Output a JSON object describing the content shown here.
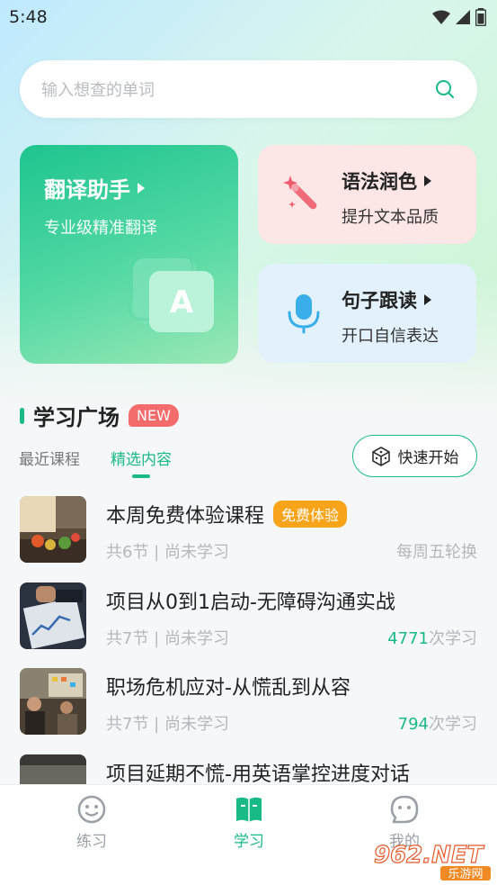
{
  "status_bar": {
    "time": "5:48"
  },
  "search": {
    "placeholder": "输入想查的单词"
  },
  "cards": {
    "translate": {
      "title": "翻译助手",
      "subtitle": "专业级精准翻译",
      "icon_letter": "A"
    },
    "grammar": {
      "title": "语法润色",
      "subtitle": "提升文本品质"
    },
    "reading": {
      "title": "句子跟读",
      "subtitle": "开口自信表达"
    }
  },
  "section": {
    "title": "学习广场",
    "badge": "NEW"
  },
  "tabs": [
    {
      "label": "最近课程",
      "active": false
    },
    {
      "label": "精选内容",
      "active": true
    }
  ],
  "quick_start": {
    "label": "快速开始"
  },
  "courses": [
    {
      "title": "本周免费体验课程",
      "badge": "免费体验",
      "meta": "共6节 | 尚未学习",
      "right_text": "每周五轮换"
    },
    {
      "title": "项目从0到1启动-无障碍沟通实战",
      "meta": "共7节 | 尚未学习",
      "count": "4771",
      "count_suffix": "次学习"
    },
    {
      "title": "职场危机应对-从慌乱到从容",
      "meta": "共7节 | 尚未学习",
      "count": "794",
      "count_suffix": "次学习"
    },
    {
      "title": "项目延期不慌-用英语掌控进度对话"
    }
  ],
  "bottom_nav": [
    {
      "label": "练习",
      "icon": "smile-icon",
      "active": false
    },
    {
      "label": "学习",
      "icon": "book-icon",
      "active": true
    },
    {
      "label": "我的",
      "icon": "chat-face-icon",
      "active": false
    }
  ],
  "watermark": {
    "text": "962.NET",
    "sub": "乐游网"
  },
  "colors": {
    "accent": "#1ab988",
    "badge_new": "#f46b6b",
    "badge_free": "#f7a41b"
  }
}
